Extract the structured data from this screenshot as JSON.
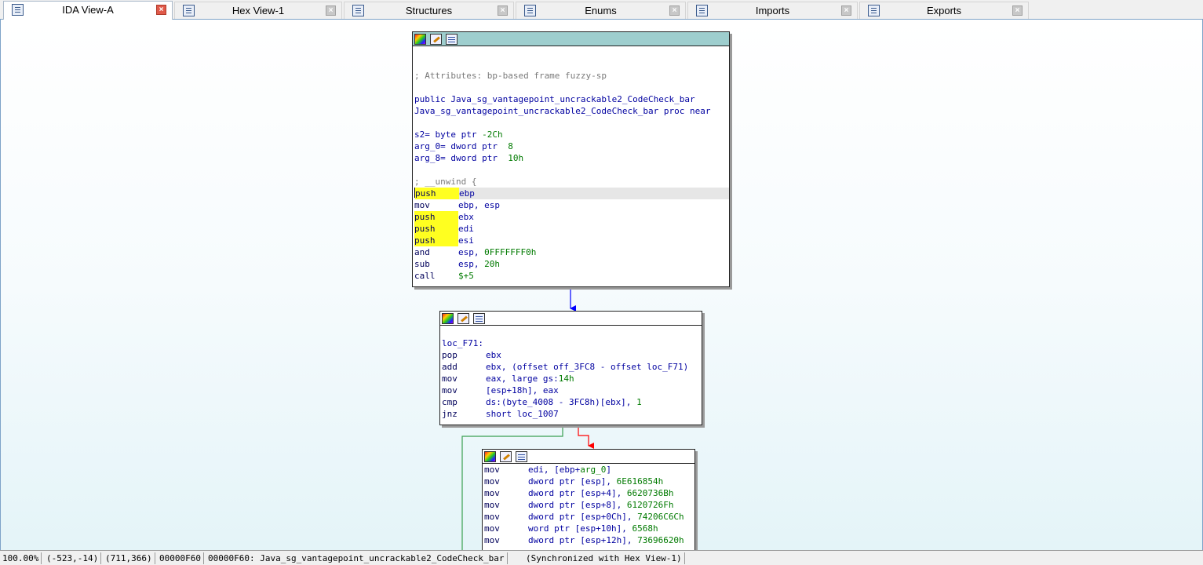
{
  "tabs": [
    {
      "label": "IDA View-A",
      "active": true,
      "icon": "ida-view-icon"
    },
    {
      "label": "Hex View-1",
      "active": false,
      "icon": "hex-view-icon"
    },
    {
      "label": "Structures",
      "active": false,
      "icon": "structures-icon"
    },
    {
      "label": "Enums",
      "active": false,
      "icon": "enums-icon"
    },
    {
      "label": "Imports",
      "active": false,
      "icon": "imports-icon"
    },
    {
      "label": "Exports",
      "active": false,
      "icon": "exports-icon"
    }
  ],
  "tab_close_glyph": "×",
  "nodes": [
    {
      "lines": [
        {
          "text": ""
        },
        {
          "text": ""
        },
        {
          "comment": "; Attributes: bp-based frame fuzzy-sp"
        },
        {
          "text": ""
        },
        {
          "text": "public Java_sg_vantagepoint_uncrackable2_CodeCheck_bar"
        },
        {
          "text": "Java_sg_vantagepoint_uncrackable2_CodeCheck_bar proc near"
        },
        {
          "text": ""
        },
        {
          "text": "s2= byte ptr ",
          "num": "-2Ch"
        },
        {
          "text": "arg_0= dword ptr  ",
          "num": "8"
        },
        {
          "text": "arg_8= dword ptr  ",
          "num": "10h"
        },
        {
          "text": ""
        },
        {
          "comment": "; __unwind {"
        },
        {
          "mn": "push",
          "ops": "ebp",
          "hl": true,
          "sel": true
        },
        {
          "mn": "mov",
          "ops": "ebp, esp"
        },
        {
          "mn": "push",
          "ops": "ebx",
          "hl": true
        },
        {
          "mn": "push",
          "ops": "edi",
          "hl": true
        },
        {
          "mn": "push",
          "ops": "esi",
          "hl": true
        },
        {
          "mn": "and",
          "ops": "esp, ",
          "num": "0FFFFFFF0h"
        },
        {
          "mn": "sub",
          "ops": "esp, ",
          "num": "20h"
        },
        {
          "mn": "call",
          "ops": "",
          "num": "$+5"
        }
      ]
    },
    {
      "lines": [
        {
          "text": ""
        },
        {
          "text": "loc_F71:"
        },
        {
          "mn": "pop",
          "ops": "ebx"
        },
        {
          "mn": "add",
          "ops": "ebx, (offset off_3FC8 - offset loc_F71)"
        },
        {
          "mn": "mov",
          "ops": "eax, large gs:",
          "num": "14h"
        },
        {
          "mn": "mov",
          "ops": "[esp+18h], eax"
        },
        {
          "mn": "cmp",
          "ops": "ds:(byte_4008 - 3FC8h)[ebx], ",
          "num": "1"
        },
        {
          "mn": "jnz",
          "ops": "short loc_1007"
        }
      ]
    },
    {
      "lines": [
        {
          "mn": "mov",
          "ops": "edi, [ebp+",
          "num": "arg_0",
          "post": "]"
        },
        {
          "mn": "mov",
          "ops": "dword ptr [esp], ",
          "num": "6E616854h"
        },
        {
          "mn": "mov",
          "ops": "dword ptr [esp+4], ",
          "num": "6620736Bh"
        },
        {
          "mn": "mov",
          "ops": "dword ptr [esp+8], ",
          "num": "6120726Fh"
        },
        {
          "mn": "mov",
          "ops": "dword ptr [esp+0Ch], ",
          "num": "74206C6Ch"
        },
        {
          "mn": "mov",
          "ops": "word ptr [esp+10h], ",
          "num": "6568h"
        },
        {
          "mn": "mov",
          "ops": "dword ptr [esp+12h], ",
          "num": "73696620h"
        }
      ]
    }
  ],
  "status": {
    "zoom": "100.00%",
    "graph_coords": "(-523,-14)",
    "mouse_coords": "(711,366)",
    "offset": "00000F60",
    "location": "00000F60: Java_sg_vantagepoint_uncrackable2_CodeCheck_bar",
    "sync": "(Synchronized with Hex View-1)"
  },
  "colors": {
    "highlight": "#ffff20",
    "node_title_selected": "#9ecece",
    "edge_true": "#0000ff",
    "edge_taken": "#ff0000",
    "edge_fallthrough": "#3aa050"
  }
}
